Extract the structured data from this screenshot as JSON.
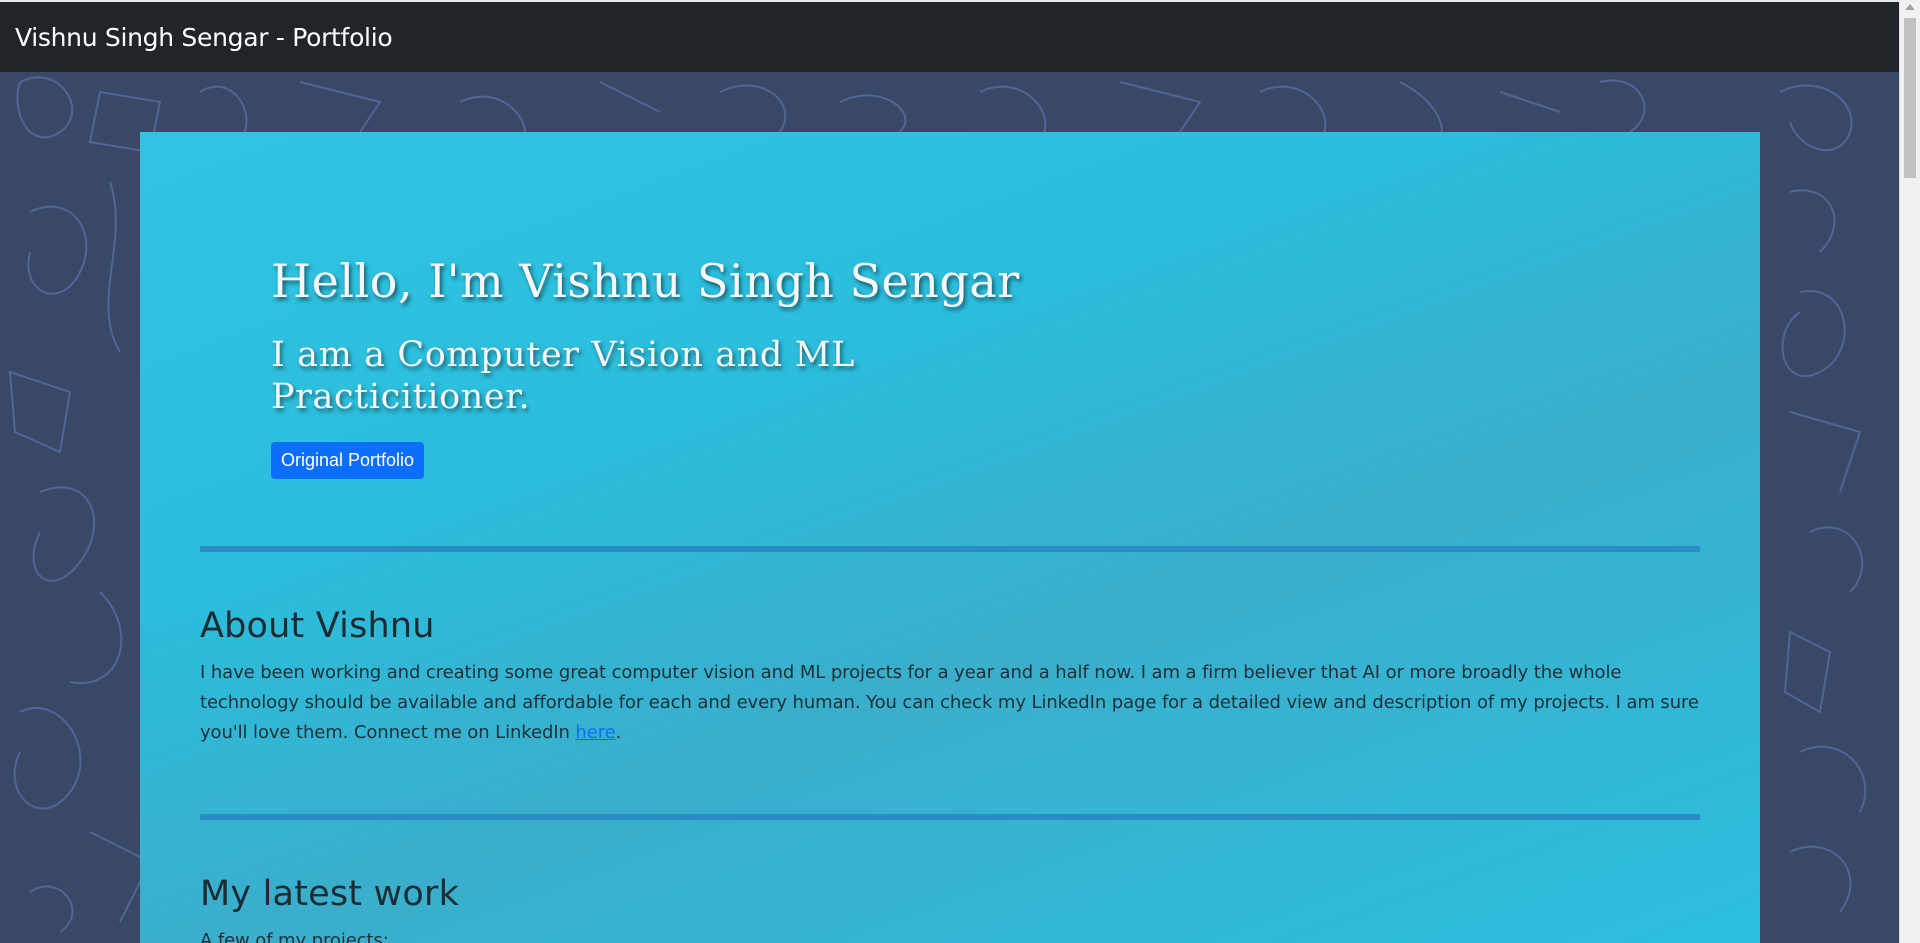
{
  "navbar": {
    "brand": "Vishnu Singh Sengar - Portfolio"
  },
  "hero": {
    "greeting": "Hello, I'm Vishnu Singh Sengar",
    "tagline": "I am a Computer Vision and ML Practicitioner.",
    "button_label": "Original Portfolio"
  },
  "about": {
    "heading": "About Vishnu",
    "body": "I have been working and creating some great computer vision and ML projects for a year and a half now. I am a firm believer that AI or more broadly the whole technology should be available and affordable for each and every human. You can check my LinkedIn page for a detailed view and description of my projects. I am sure you'll love them. Connect me on LinkedIn ",
    "link_label": "here",
    "trailing": "."
  },
  "work": {
    "heading": "My latest work",
    "intro": "A few of my projects:"
  },
  "colors": {
    "navbar": "#212529",
    "page_background": "#3a4868",
    "card": "#2dc0e0",
    "button": "#0d6efd",
    "divider": "#2a8cc4"
  }
}
